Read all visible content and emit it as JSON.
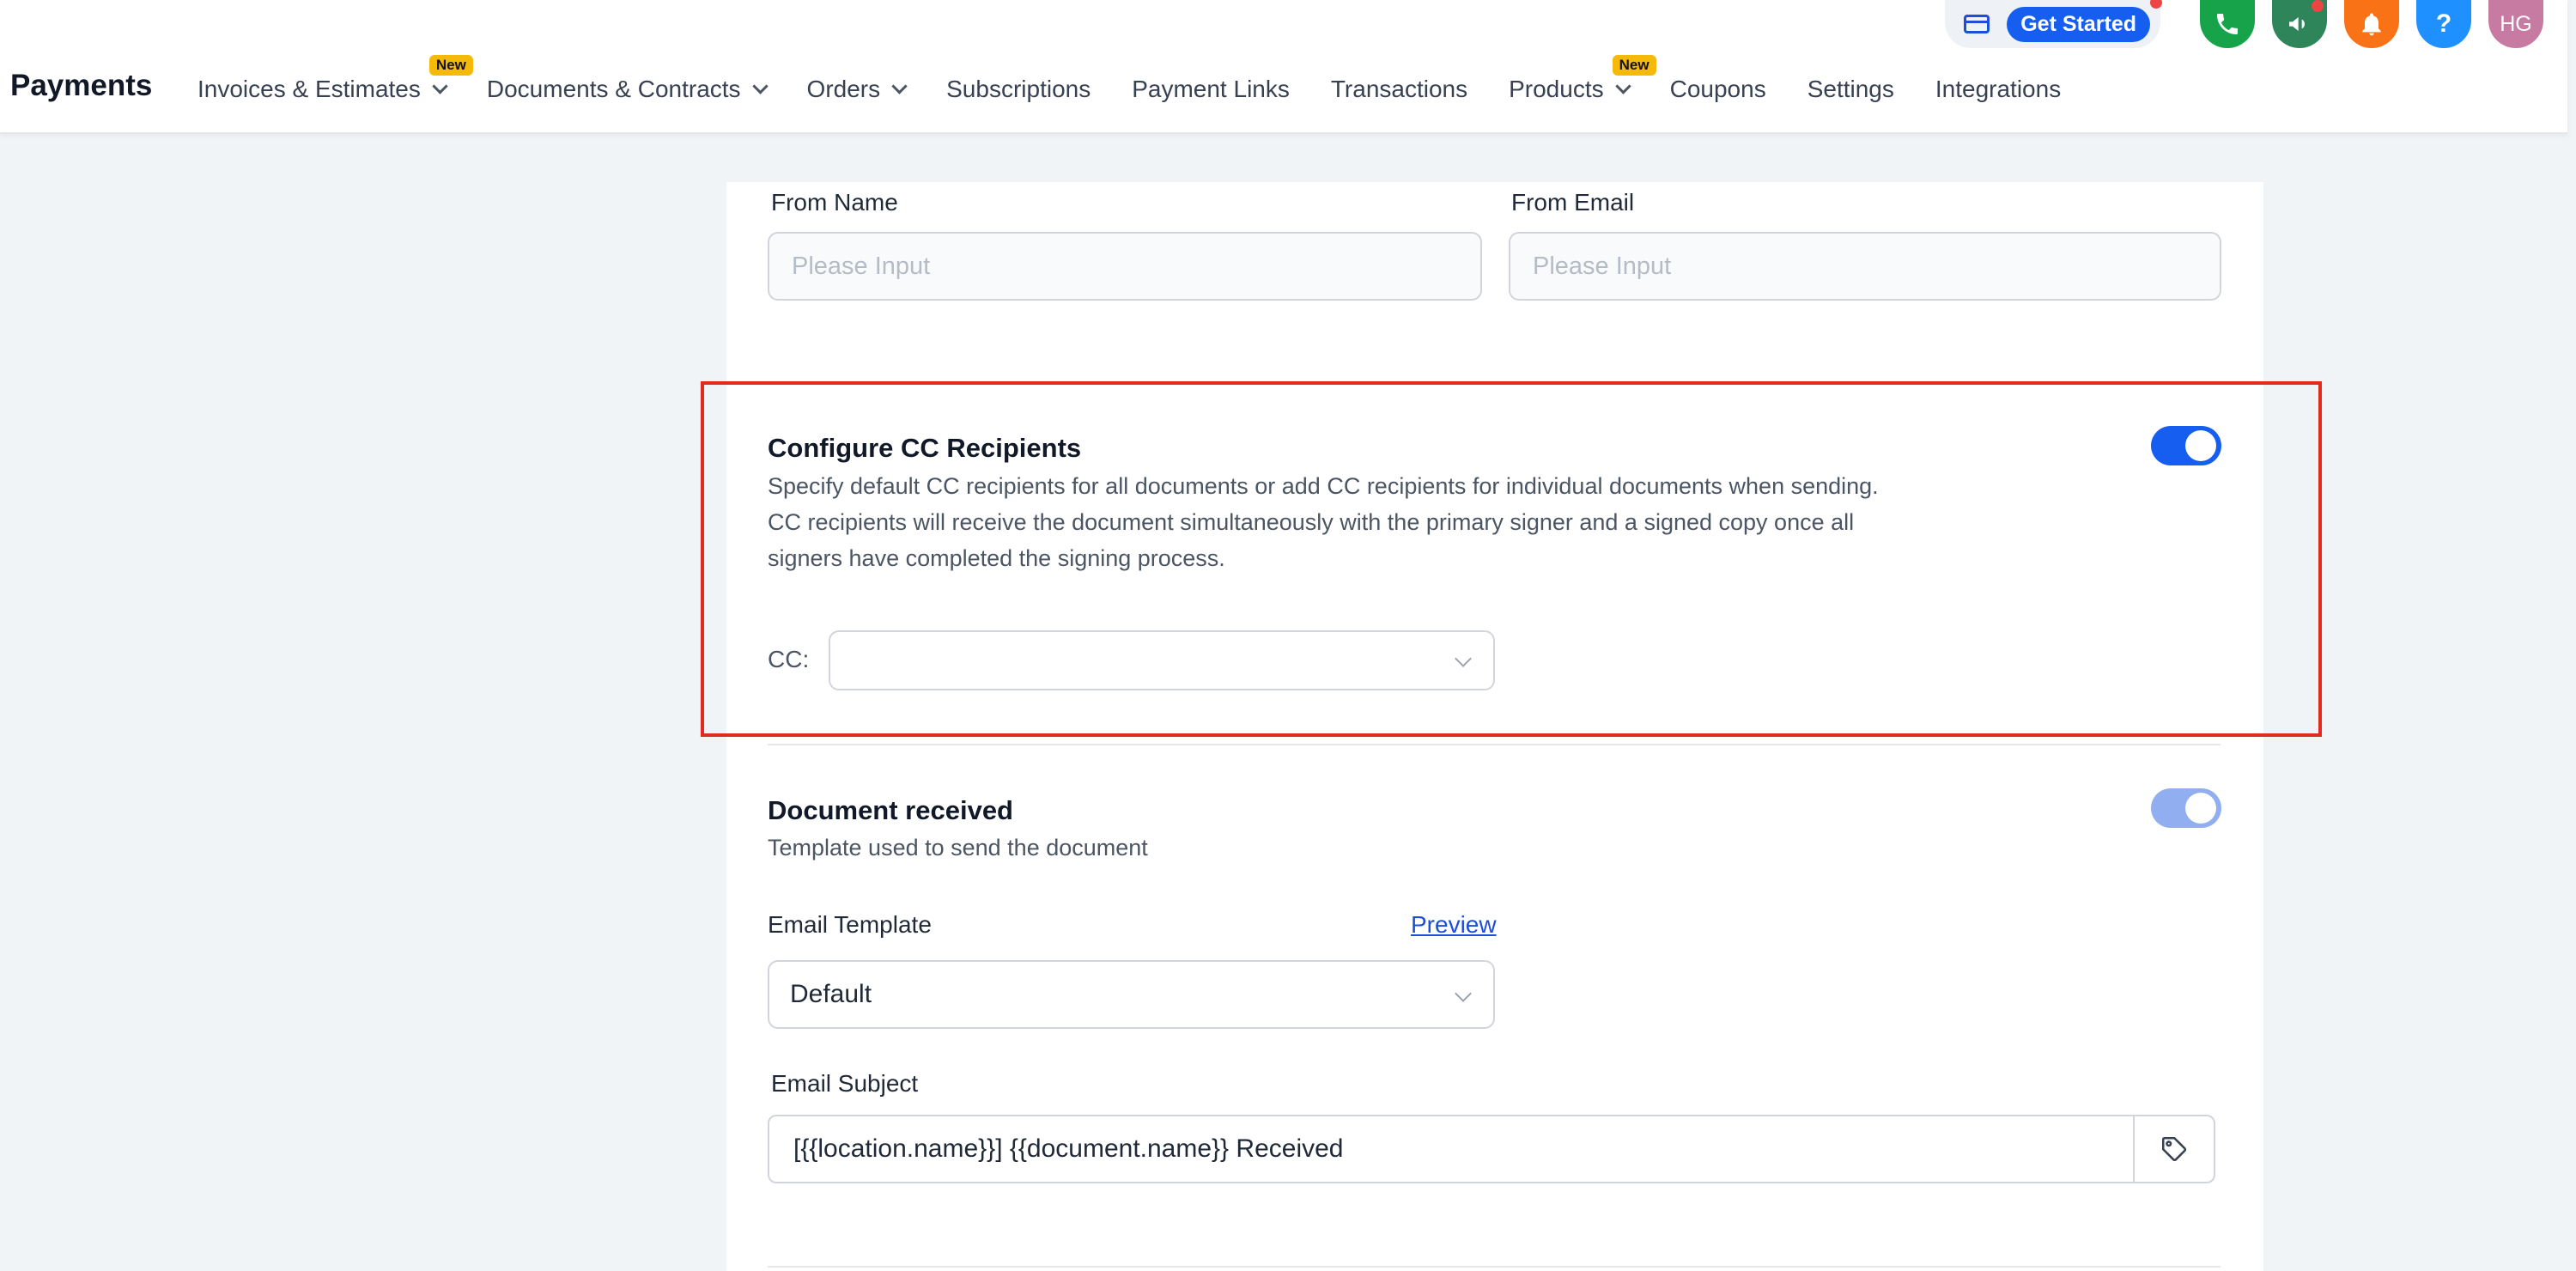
{
  "header": {
    "title": "Payments",
    "nav": [
      {
        "label": "Invoices & Estimates",
        "dropdown": true,
        "badge": "New"
      },
      {
        "label": "Documents & Contracts",
        "dropdown": true,
        "badge": ""
      },
      {
        "label": "Orders",
        "dropdown": true,
        "badge": ""
      },
      {
        "label": "Subscriptions",
        "dropdown": false,
        "badge": ""
      },
      {
        "label": "Payment Links",
        "dropdown": false,
        "badge": ""
      },
      {
        "label": "Transactions",
        "dropdown": false,
        "badge": ""
      },
      {
        "label": "Products",
        "dropdown": true,
        "badge": "New"
      },
      {
        "label": "Coupons",
        "dropdown": false,
        "badge": ""
      },
      {
        "label": "Settings",
        "dropdown": false,
        "badge": ""
      },
      {
        "label": "Integrations",
        "dropdown": false,
        "badge": ""
      }
    ],
    "get_started_label": "Get Started",
    "help_label": "?",
    "avatar_initials": "HG",
    "icon_colors": {
      "phone": "#16a34a",
      "megaphone": "#2f855a",
      "bell": "#f97316",
      "help": "#1e90ff",
      "avatar": "#c77ba3"
    }
  },
  "sender": {
    "from_name_label": "From Name",
    "from_name_placeholder": "Please Input",
    "from_email_label": "From Email",
    "from_email_placeholder": "Please Input"
  },
  "cc_section": {
    "title": "Configure CC Recipients",
    "description_lines": [
      "Specify default CC recipients for all documents or add CC recipients for individual documents when sending.",
      "CC recipients will receive the document simultaneously with the primary signer and a signed copy once all",
      "signers have completed the signing process."
    ],
    "enabled": true,
    "cc_label": "CC:",
    "cc_value": ""
  },
  "document_received": {
    "title": "Document received",
    "description": "Template used to send the document",
    "enabled": true,
    "email_template_label": "Email Template",
    "preview_label": "Preview",
    "email_template_value": "Default",
    "email_subject_label": "Email Subject",
    "email_subject_value": "[{{location.name}}] {{document.name}} Received"
  }
}
